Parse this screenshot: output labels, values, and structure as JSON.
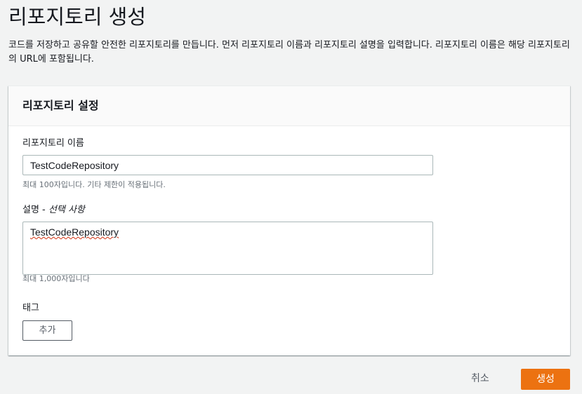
{
  "page": {
    "title": "리포지토리 생성",
    "description": "코드를 저장하고 공유할 안전한 리포지토리를 만듭니다. 먼저 리포지토리 이름과 리포지토리 설명을 입력합니다. 리포지토리 이름은 해당 리포지토리의 URL에 포함됩니다."
  },
  "settings": {
    "title": "리포지토리 설정",
    "name": {
      "label": "리포지토리 이름",
      "value": "TestCodeRepository",
      "hint": "최대 100자입니다. 기타 제한이 적용됩니다."
    },
    "description": {
      "label": "설명",
      "separator": " - ",
      "optional_label": "선택 사항",
      "value": "TestCodeRepository",
      "hint": "최대 1,000자입니다"
    },
    "tags": {
      "label": "태그",
      "add_button": "추가"
    }
  },
  "actions": {
    "cancel": "취소",
    "create": "생성"
  },
  "colors": {
    "primary": "#ec7211",
    "background": "#f2f3f3",
    "border": "#aab7b8"
  }
}
